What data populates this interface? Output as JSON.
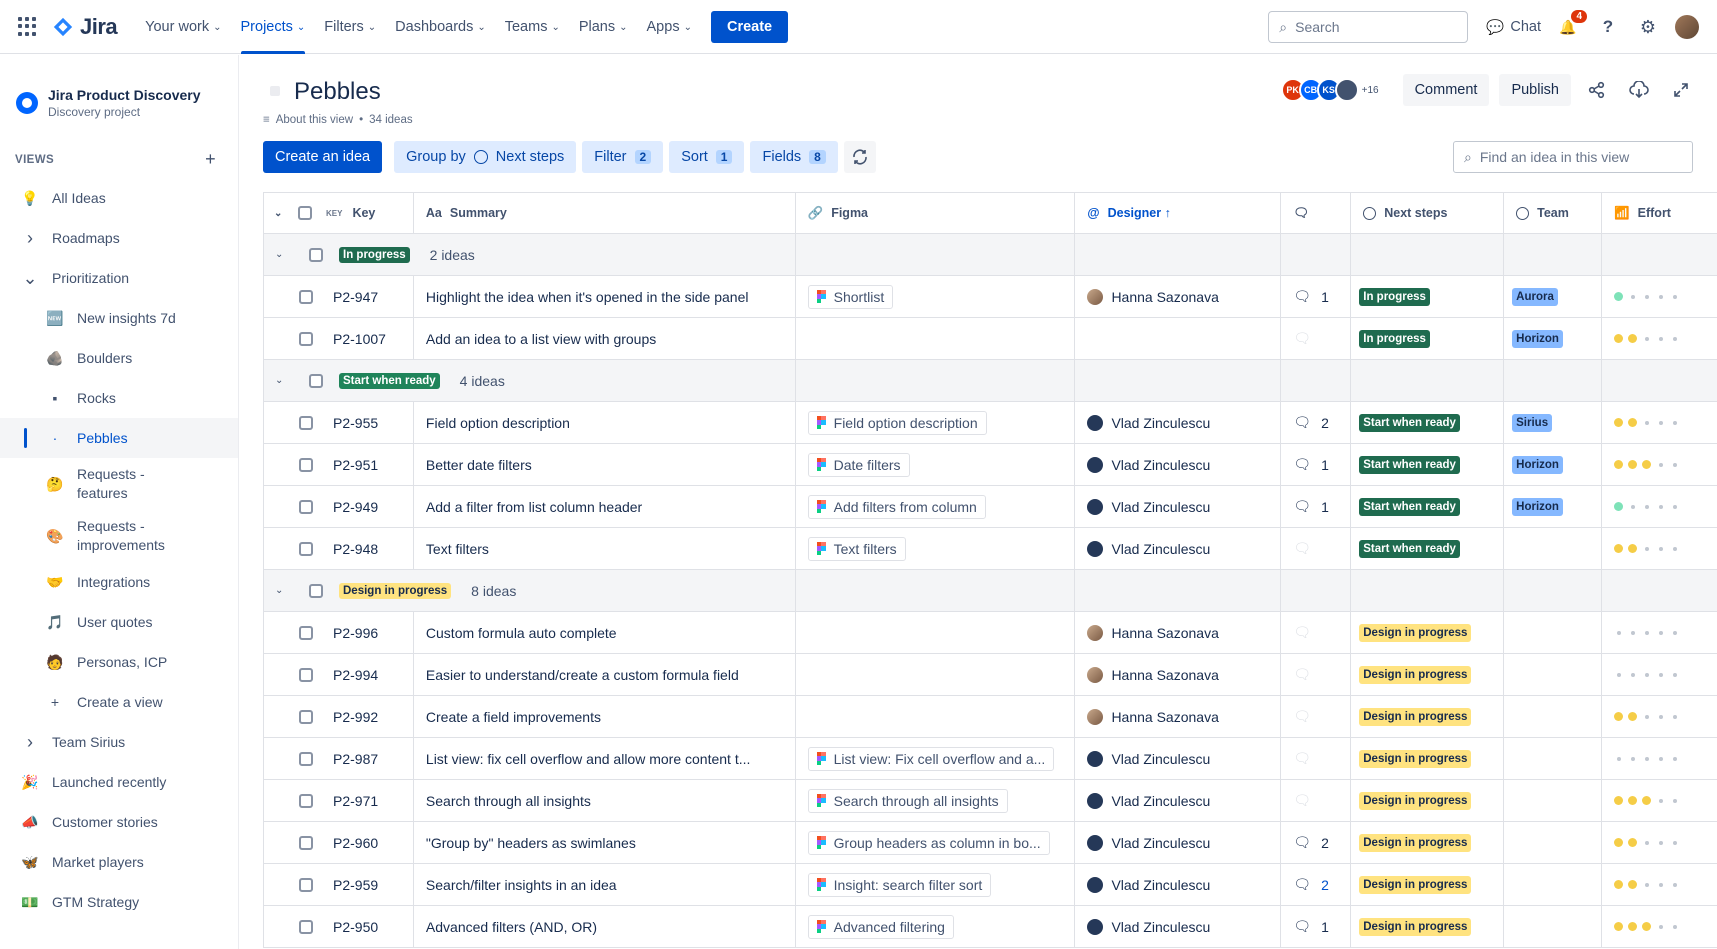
{
  "nav": {
    "logo": "Jira",
    "items": [
      "Your work",
      "Projects",
      "Filters",
      "Dashboards",
      "Teams",
      "Plans",
      "Apps"
    ],
    "active_index": 1,
    "create": "Create",
    "search_placeholder": "Search",
    "chat": "Chat",
    "notification_count": "4"
  },
  "project": {
    "name": "Jira Product Discovery",
    "type": "Discovery project"
  },
  "sidebar": {
    "views_label": "VIEWS",
    "items": [
      {
        "label": "All Ideas",
        "icon": "lightbulb-icon",
        "glyph": "💡",
        "level": 0
      },
      {
        "label": "Roadmaps",
        "icon": "chevron-right-icon",
        "glyph": "›",
        "level": 0
      },
      {
        "label": "Prioritization",
        "icon": "chevron-down-icon",
        "glyph": "⌄",
        "level": 0
      },
      {
        "label": "New insights 7d",
        "icon": "new-badge-icon",
        "glyph": "🆕",
        "level": 1
      },
      {
        "label": "Boulders",
        "icon": "rock-icon",
        "glyph": "🪨",
        "level": 1
      },
      {
        "label": "Rocks",
        "icon": "pebble-icon",
        "glyph": "▪",
        "level": 1
      },
      {
        "label": "Pebbles",
        "icon": "pebble-small-icon",
        "glyph": "·",
        "level": 1,
        "active": true
      },
      {
        "label": "Requests - features",
        "icon": "face-icon",
        "glyph": "🤔",
        "level": 1,
        "two": true
      },
      {
        "label": "Requests - improvements",
        "icon": "palette-icon",
        "glyph": "🎨",
        "level": 1,
        "two": true
      },
      {
        "label": "Integrations",
        "icon": "handshake-icon",
        "glyph": "🤝",
        "level": 1
      },
      {
        "label": "User quotes",
        "icon": "music-icon",
        "glyph": "🎵",
        "level": 1
      },
      {
        "label": "Personas, ICP",
        "icon": "person-icon",
        "glyph": "🧑",
        "level": 1
      },
      {
        "label": "Create a view",
        "icon": "plus-icon",
        "glyph": "+",
        "level": 1
      },
      {
        "label": "Team Sirius",
        "icon": "chevron-right-icon",
        "glyph": "›",
        "level": 0
      },
      {
        "label": "Launched recently",
        "icon": "party-icon",
        "glyph": "🎉",
        "level": 0
      },
      {
        "label": "Customer stories",
        "icon": "megaphone-icon",
        "glyph": "📣",
        "level": 0
      },
      {
        "label": "Market players",
        "icon": "butterfly-icon",
        "glyph": "🦋",
        "level": 0
      },
      {
        "label": "GTM Strategy",
        "icon": "money-icon",
        "glyph": "💵",
        "level": 0
      }
    ]
  },
  "header": {
    "title": "Pebbles",
    "about": "About this view",
    "ideas_count": "34 ideas",
    "avatars": [
      {
        "initials": "PK",
        "color": "#DE350B"
      },
      {
        "initials": "CB",
        "color": "#0065FF"
      },
      {
        "initials": "KS",
        "color": "#0052CC"
      },
      {
        "initials": "",
        "color": "#42526E"
      }
    ],
    "more_avatars": "+16",
    "comment": "Comment",
    "publish": "Publish"
  },
  "toolbar": {
    "create_idea": "Create an idea",
    "group_by": "Group by",
    "group_value": "Next steps",
    "filter": "Filter",
    "filter_count": "2",
    "sort": "Sort",
    "sort_count": "1",
    "fields": "Fields",
    "fields_count": "8",
    "find_placeholder": "Find an idea in this view"
  },
  "columns": {
    "key": "Key",
    "key_tag": "KEY",
    "summary": "Summary",
    "figma": "Figma",
    "designer": "Designer ↑",
    "next_steps": "Next steps",
    "team": "Team",
    "effort": "Effort"
  },
  "groups": [
    {
      "name": "In progress",
      "style": "grp-ip",
      "count": "2 ideas",
      "rows": [
        {
          "key": "P2-947",
          "summary": "Highlight the idea when it's opened in the side panel",
          "figma": "Shortlist",
          "designer": "Hanna Sazonava",
          "av": "h",
          "comments": "1",
          "next": "In progress",
          "ns": "ns-ip",
          "team": "Aurora",
          "effort": 1,
          "ecolor": "g"
        },
        {
          "key": "P2-1007",
          "summary": "Add an idea to a list view with groups",
          "figma": "",
          "designer": "",
          "av": "",
          "comments": "",
          "next": "In progress",
          "ns": "ns-ip",
          "team": "Horizon",
          "effort": 2,
          "ecolor": "y"
        }
      ]
    },
    {
      "name": "Start when ready",
      "style": "grp-swr",
      "count": "4 ideas",
      "rows": [
        {
          "key": "P2-955",
          "summary": "Field option description",
          "figma": "Field option description",
          "designer": "Vlad Zinculescu",
          "av": "v",
          "comments": "2",
          "next": "Start when ready",
          "ns": "ns-swr",
          "team": "Sirius",
          "effort": 2,
          "ecolor": "y"
        },
        {
          "key": "P2-951",
          "summary": "Better date filters",
          "figma": "Date filters",
          "designer": "Vlad Zinculescu",
          "av": "v",
          "comments": "1",
          "next": "Start when ready",
          "ns": "ns-swr",
          "team": "Horizon",
          "effort": 3,
          "ecolor": "y"
        },
        {
          "key": "P2-949",
          "summary": "Add a filter from list column header",
          "figma": "Add filters from column",
          "designer": "Vlad Zinculescu",
          "av": "v",
          "comments": "1",
          "next": "Start when ready",
          "ns": "ns-swr",
          "team": "Horizon",
          "effort": 1,
          "ecolor": "g"
        },
        {
          "key": "P2-948",
          "summary": "Text filters",
          "figma": "Text filters",
          "designer": "Vlad Zinculescu",
          "av": "v",
          "comments": "",
          "next": "Start when ready",
          "ns": "ns-swr",
          "team": "",
          "effort": 2,
          "ecolor": "y"
        }
      ]
    },
    {
      "name": "Design in progress",
      "style": "grp-dip",
      "count": "8 ideas",
      "rows": [
        {
          "key": "P2-996",
          "summary": "Custom formula auto complete",
          "figma": "",
          "designer": "Hanna Sazonava",
          "av": "h",
          "comments": "",
          "next": "Design in progress",
          "ns": "ns-dip",
          "team": "",
          "effort": 0,
          "ecolor": "y"
        },
        {
          "key": "P2-994",
          "summary": "Easier to understand/create a custom formula field",
          "figma": "",
          "designer": "Hanna Sazonava",
          "av": "h",
          "comments": "",
          "next": "Design in progress",
          "ns": "ns-dip",
          "team": "",
          "effort": 0,
          "ecolor": "y"
        },
        {
          "key": "P2-992",
          "summary": "Create a field improvements",
          "figma": "",
          "designer": "Hanna Sazonava",
          "av": "h",
          "comments": "",
          "next": "Design in progress",
          "ns": "ns-dip",
          "team": "",
          "effort": 2,
          "ecolor": "y"
        },
        {
          "key": "P2-987",
          "summary": "List view: fix cell overflow and allow more content t...",
          "figma": "List view: Fix cell overflow and a...",
          "designer": "Vlad Zinculescu",
          "av": "v",
          "comments": "",
          "next": "Design in progress",
          "ns": "ns-dip",
          "team": "",
          "effort": 0,
          "ecolor": "y"
        },
        {
          "key": "P2-971",
          "summary": "Search through all insights",
          "figma": "Search through all insights",
          "designer": "Vlad Zinculescu",
          "av": "v",
          "comments": "",
          "next": "Design in progress",
          "ns": "ns-dip",
          "team": "",
          "effort": 3,
          "ecolor": "y"
        },
        {
          "key": "P2-960",
          "summary": "\"Group by\" headers as swimlanes",
          "figma": "Group headers as column in bo...",
          "designer": "Vlad Zinculescu",
          "av": "v",
          "comments": "2",
          "next": "Design in progress",
          "ns": "ns-dip",
          "team": "",
          "effort": 2,
          "ecolor": "y"
        },
        {
          "key": "P2-959",
          "summary": "Search/filter insights in an idea",
          "figma": "Insight: search filter sort",
          "designer": "Vlad Zinculescu",
          "av": "v",
          "comments": "2",
          "next": "Design in progress",
          "ns": "ns-dip",
          "team": "",
          "effort": 2,
          "ecolor": "y"
        },
        {
          "key": "P2-950",
          "summary": "Advanced filters (AND, OR)",
          "figma": "Advanced filtering",
          "designer": "Vlad Zinculescu",
          "av": "v",
          "comments": "1",
          "next": "Design in progress",
          "ns": "ns-dip",
          "team": "",
          "effort": 3,
          "ecolor": "y"
        }
      ]
    }
  ]
}
